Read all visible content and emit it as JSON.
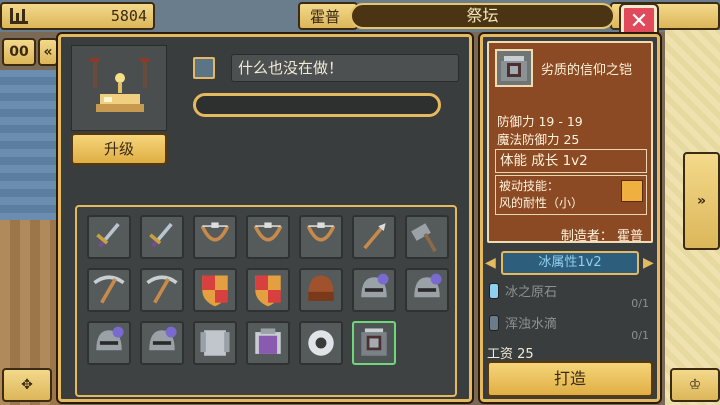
{
  "top_bar": {
    "gold_amount": "5804",
    "hero_tab_label": "霍普",
    "title": "祭坛",
    "close_glyph": "✕"
  },
  "side_controls": {
    "pause_glyph": "00",
    "rewind_glyph": "«",
    "next_glyph": "»",
    "dpad_glyph": "✥",
    "crown_glyph": "♔"
  },
  "altar": {
    "upgrade_label": "升级",
    "status_text": "什么也没在做！",
    "progress": 0
  },
  "items": [
    {
      "name": "sword-icon",
      "color": "#b9c4d0"
    },
    {
      "name": "sword-icon",
      "color": "#b9c4d0"
    },
    {
      "name": "bow-icon",
      "color": "#c88a4a"
    },
    {
      "name": "bow-icon",
      "color": "#c88a4a"
    },
    {
      "name": "bow-icon",
      "color": "#c88a4a"
    },
    {
      "name": "spear-icon",
      "color": "#c88a4a"
    },
    {
      "name": "hammer-icon",
      "color": "#9aa2a8"
    },
    {
      "name": "pickaxe-icon",
      "color": "#c88a4a"
    },
    {
      "name": "pickaxe-icon",
      "color": "#c88a4a"
    },
    {
      "name": "shield-icon",
      "color": "#e4a040"
    },
    {
      "name": "shield-icon",
      "color": "#e4a040"
    },
    {
      "name": "leather-helmet-icon",
      "color": "#a0522d"
    },
    {
      "name": "knight-helmet-icon",
      "color": "#9aa2a8"
    },
    {
      "name": "knight-helmet-icon",
      "color": "#9aa2a8"
    },
    {
      "name": "knight-helmet-icon",
      "color": "#9aa2a8"
    },
    {
      "name": "knight-helmet-icon",
      "color": "#9aa2a8"
    },
    {
      "name": "chainmail-icon",
      "color": "#c0c6cc"
    },
    {
      "name": "ornate-armor-icon",
      "color": "#8a5ab0"
    },
    {
      "name": "ring-icon",
      "color": "#e0e4e8"
    },
    {
      "name": "armor-icon",
      "color": "#7a8288"
    }
  ],
  "selected_index": 19,
  "detail": {
    "item_name": "劣质的信仰之铠",
    "defense": "防御力 19 - 19",
    "magic_defense": "魔法防御力 25",
    "growth": "体能 成长 1v2",
    "passive_title": "被动技能：",
    "passive_name": "风的耐性（小）",
    "maker": "制造者： 霍普",
    "attribute": "冰属性1v2",
    "materials": [
      {
        "name": "冰之原石",
        "count": "0/1",
        "color": "#8fd0f0"
      },
      {
        "name": "浑浊水滴",
        "count": "0/1",
        "color": "#6a7c8a"
      }
    ],
    "wage": "工资 25",
    "forge_label": "打造"
  }
}
